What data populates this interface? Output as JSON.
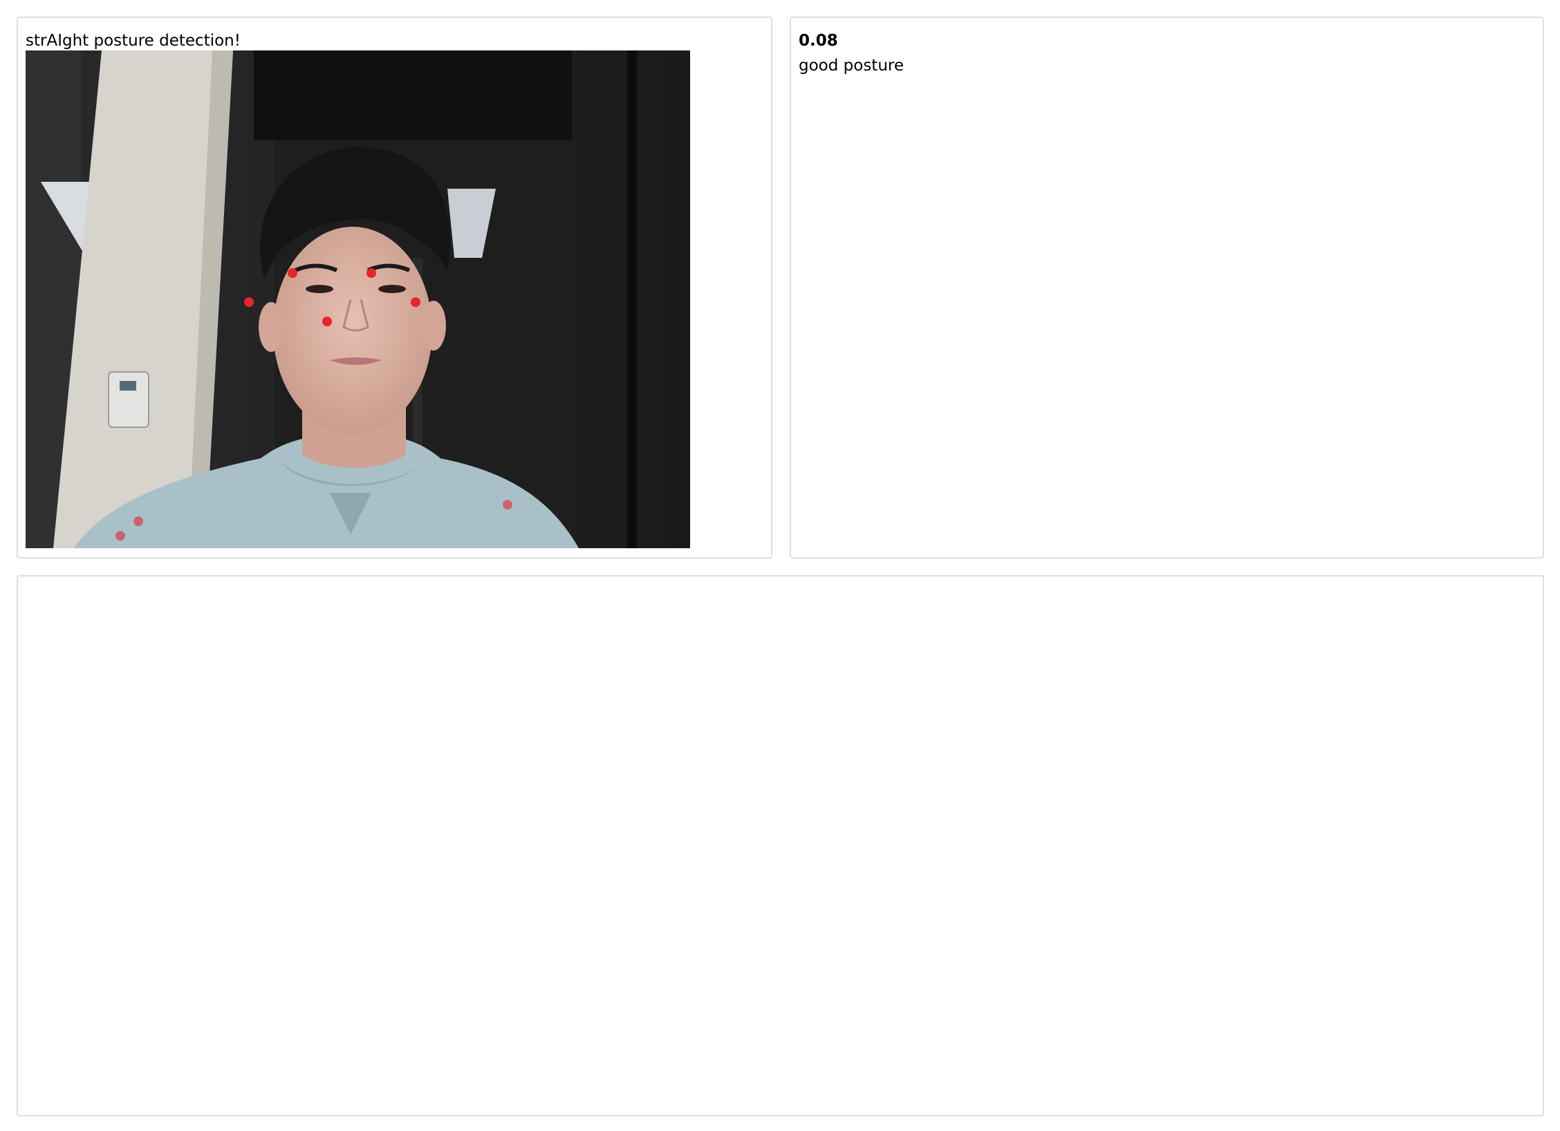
{
  "camera_panel": {
    "title": "strAIght posture detection!",
    "feed": "webcam-feed",
    "keypoint_color": "#e5262b"
  },
  "status_panel": {
    "score": "0.08",
    "verdict": "good posture"
  },
  "bottom_panel": {}
}
